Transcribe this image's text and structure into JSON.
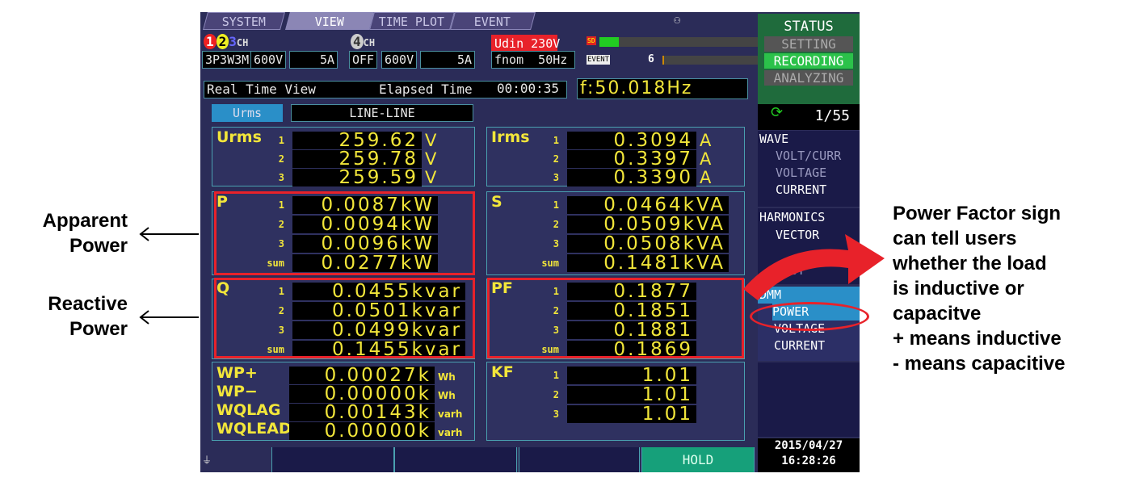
{
  "tabs": [
    {
      "label": "SYSTEM"
    },
    {
      "label": "VIEW"
    },
    {
      "label": "TIME PLOT"
    },
    {
      "label": "EVENT"
    }
  ],
  "channels": {
    "ch123_label": "CH",
    "ch123_wiring": "3P3W3M",
    "ch123_voltage": "600V",
    "ch123_current": "5A",
    "ch4_label": "CH",
    "ch4_wiring": "OFF",
    "ch4_voltage": "600V",
    "ch4_current": "5A"
  },
  "udin": "Udin 230V",
  "fnom": "fnom  50Hz",
  "event_badge": "EVENT",
  "event_count": "6",
  "sd_label": "SD",
  "status_line": {
    "view": "Real Time View",
    "elapsed_label": "Elapsed Time",
    "elapsed": "00:00:35",
    "freq": "f:50.018Hz"
  },
  "mode": {
    "button": "Urms",
    "connection": "LINE-LINE"
  },
  "urms": {
    "label": "Urms",
    "rows": [
      {
        "ph": "1",
        "v": "259.62",
        "u": "V"
      },
      {
        "ph": "2",
        "v": "259.78",
        "u": "V"
      },
      {
        "ph": "3",
        "v": "259.59",
        "u": "V"
      }
    ]
  },
  "irms": {
    "label": "Irms",
    "rows": [
      {
        "ph": "1",
        "v": "0.3094",
        "u": "A"
      },
      {
        "ph": "2",
        "v": "0.3397",
        "u": "A"
      },
      {
        "ph": "3",
        "v": "0.3390",
        "u": "A"
      }
    ]
  },
  "p": {
    "label": "P",
    "rows": [
      {
        "ph": "1",
        "v": "0.0087kW"
      },
      {
        "ph": "2",
        "v": "0.0094kW"
      },
      {
        "ph": "3",
        "v": "0.0096kW"
      },
      {
        "ph": "sum",
        "v": "0.0277kW"
      }
    ]
  },
  "s": {
    "label": "S",
    "rows": [
      {
        "ph": "1",
        "v": "0.0464kVA"
      },
      {
        "ph": "2",
        "v": "0.0509kVA"
      },
      {
        "ph": "3",
        "v": "0.0508kVA"
      },
      {
        "ph": "sum",
        "v": "0.1481kVA"
      }
    ]
  },
  "q": {
    "label": "Q",
    "rows": [
      {
        "ph": "1",
        "v": "0.0455kvar"
      },
      {
        "ph": "2",
        "v": "0.0501kvar"
      },
      {
        "ph": "3",
        "v": "0.0499kvar"
      },
      {
        "ph": "sum",
        "v": "0.1455kvar"
      }
    ]
  },
  "pf": {
    "label": "PF",
    "rows": [
      {
        "ph": "1",
        "v": "0.1877"
      },
      {
        "ph": "2",
        "v": "0.1851"
      },
      {
        "ph": "3",
        "v": "0.1881"
      },
      {
        "ph": "sum",
        "v": "0.1869"
      }
    ]
  },
  "energy": [
    {
      "label": "WP+",
      "v": "0.00027k",
      "u": "Wh"
    },
    {
      "label": "WP−",
      "v": "0.00000k",
      "u": "Wh"
    },
    {
      "label": "WQLAG",
      "v": "0.00143k",
      "u": "varh"
    },
    {
      "label": "WQLEAD",
      "v": "0.00000k",
      "u": "varh"
    }
  ],
  "kf": {
    "label": "KF",
    "rows": [
      {
        "ph": "1",
        "v": "1.01"
      },
      {
        "ph": "2",
        "v": "1.01"
      },
      {
        "ph": "3",
        "v": "1.01"
      }
    ]
  },
  "sidebar": {
    "status": "STATUS",
    "setting": "SETTING",
    "recording": "RECORDING",
    "analyzing": "ANALYZING",
    "page": "1/55",
    "wave": "WAVE",
    "wave_items": [
      "VOLT/CURR",
      "VOLTAGE",
      "CURRENT"
    ],
    "harmonics": "HARMONICS",
    "harm_items": [
      "VECTOR",
      "LIST"
    ],
    "dmm": "DMM",
    "dmm_items": [
      "POWER",
      "VOLTAGE",
      "CURRENT"
    ],
    "date": "2015/04/27",
    "time": "16:28:26"
  },
  "footer": {
    "hold": "HOLD"
  },
  "annotations": {
    "apparent": [
      "Apparent",
      "Power"
    ],
    "reactive": [
      "Reactive",
      "Power"
    ],
    "pf_note": [
      "Power Factor sign",
      "can tell users",
      "whether the load",
      "is inductive or",
      "capacitve",
      "+ means inductive",
      "- means capacitive"
    ]
  },
  "colors": {
    "screen_bg": "#2b2c58",
    "value_yellow": "#f2e63a",
    "highlight_red": "#e8222a",
    "status_green": "#1f6b3c",
    "hold_green": "#16a07a"
  }
}
